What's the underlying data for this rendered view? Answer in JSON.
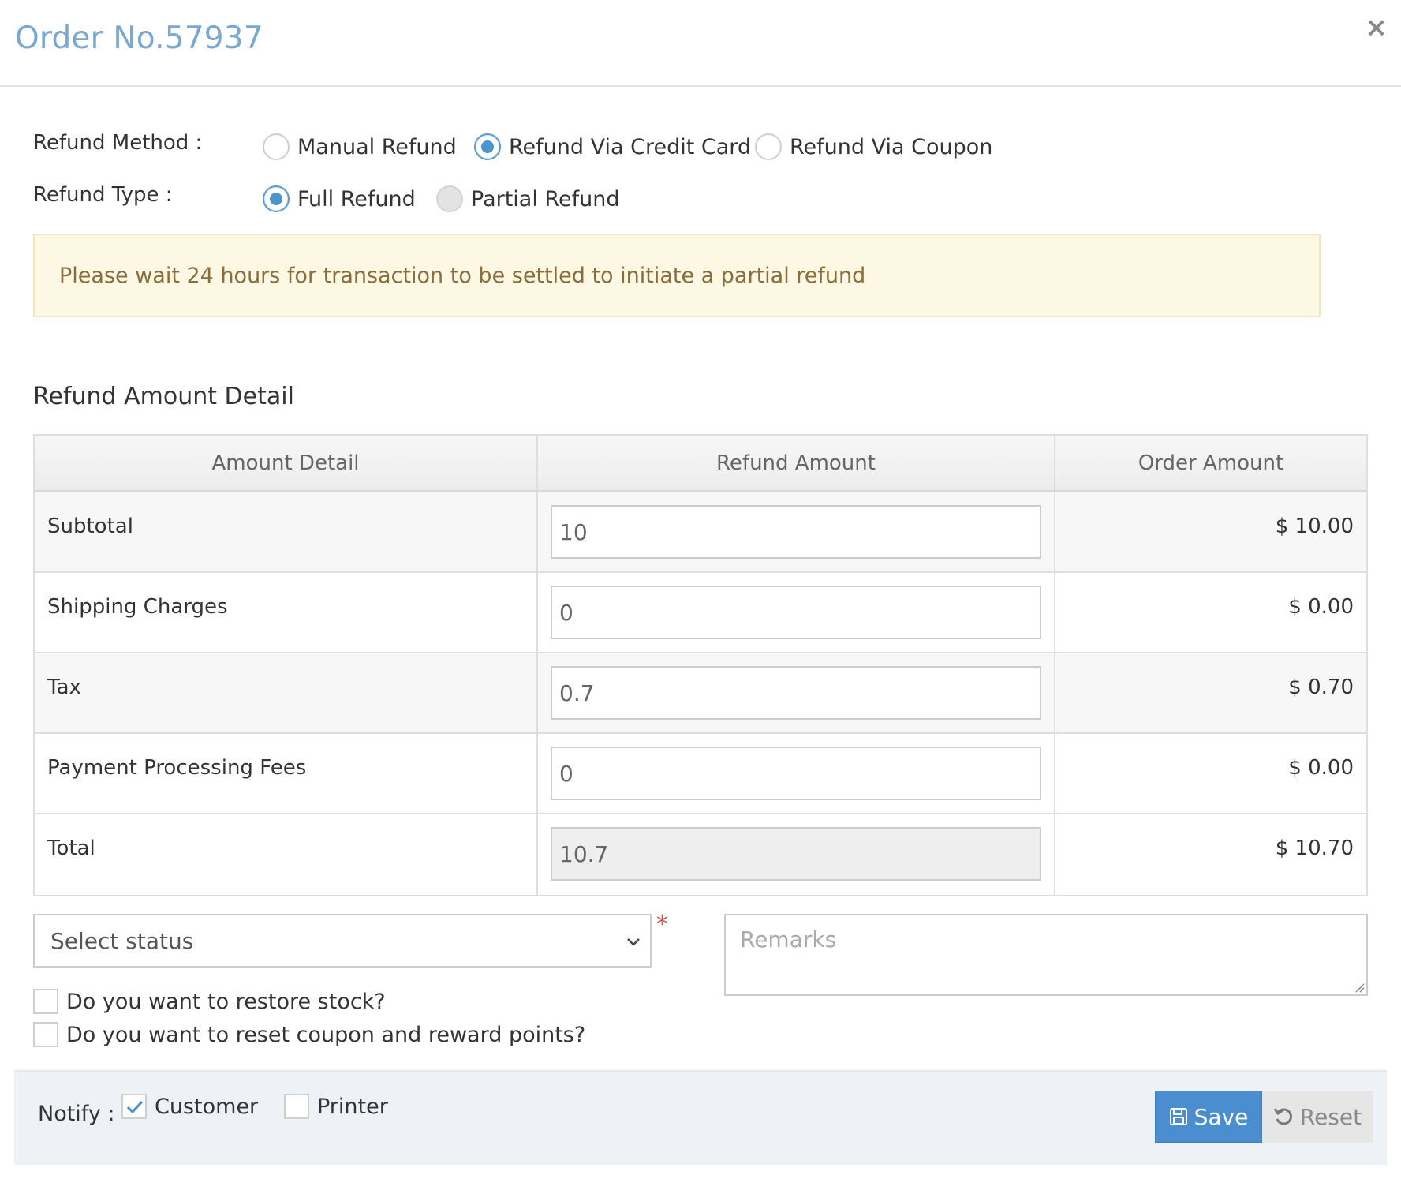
{
  "header": {
    "title": "Order No.57937",
    "close_label": "×"
  },
  "refund_method": {
    "label": "Refund Method :",
    "options": [
      {
        "label": "Manual Refund",
        "checked": false
      },
      {
        "label": "Refund Via Credit Card",
        "checked": true
      },
      {
        "label": "Refund Via Coupon",
        "checked": false
      }
    ]
  },
  "refund_type": {
    "label": "Refund Type :",
    "options": [
      {
        "label": "Full Refund",
        "checked": true
      },
      {
        "label": "Partial Refund",
        "checked": false,
        "disabled": true
      }
    ]
  },
  "alert": {
    "text": "Please wait 24 hours for transaction to be settled to initiate a partial refund"
  },
  "section_title": "Refund Amount Detail",
  "table": {
    "headers": [
      "Amount Detail",
      "Refund Amount",
      "Order Amount"
    ],
    "rows": [
      {
        "label": "Subtotal",
        "refund": "10",
        "order": "$ 10.00"
      },
      {
        "label": "Shipping Charges",
        "refund": "0",
        "order": "$ 0.00"
      },
      {
        "label": "Tax",
        "refund": "0.7",
        "order": "$ 0.70"
      },
      {
        "label": "Payment Processing Fees",
        "refund": "0",
        "order": "$ 0.00"
      },
      {
        "label": "Total",
        "refund": "10.7",
        "order": "$ 10.70"
      }
    ]
  },
  "status_select": {
    "selected": "Select status",
    "required_mark": "*"
  },
  "remarks": {
    "placeholder": "Remarks"
  },
  "checkboxes": {
    "restore_stock": {
      "label": "Do you want to restore stock?",
      "checked": false
    },
    "reset_coupon": {
      "label": "Do you want to reset coupon and reward points?",
      "checked": false
    }
  },
  "footer": {
    "notify_label": "Notify :",
    "customer": {
      "label": "Customer",
      "checked": true
    },
    "printer": {
      "label": "Printer",
      "checked": false
    },
    "save_label": "Save",
    "reset_label": "Reset"
  },
  "colors": {
    "title": "#79a9d1",
    "accent": "#4a8ed0",
    "alert_bg": "#fcf8e4",
    "alert_text": "#8a6d3b",
    "required": "#d9534f"
  }
}
